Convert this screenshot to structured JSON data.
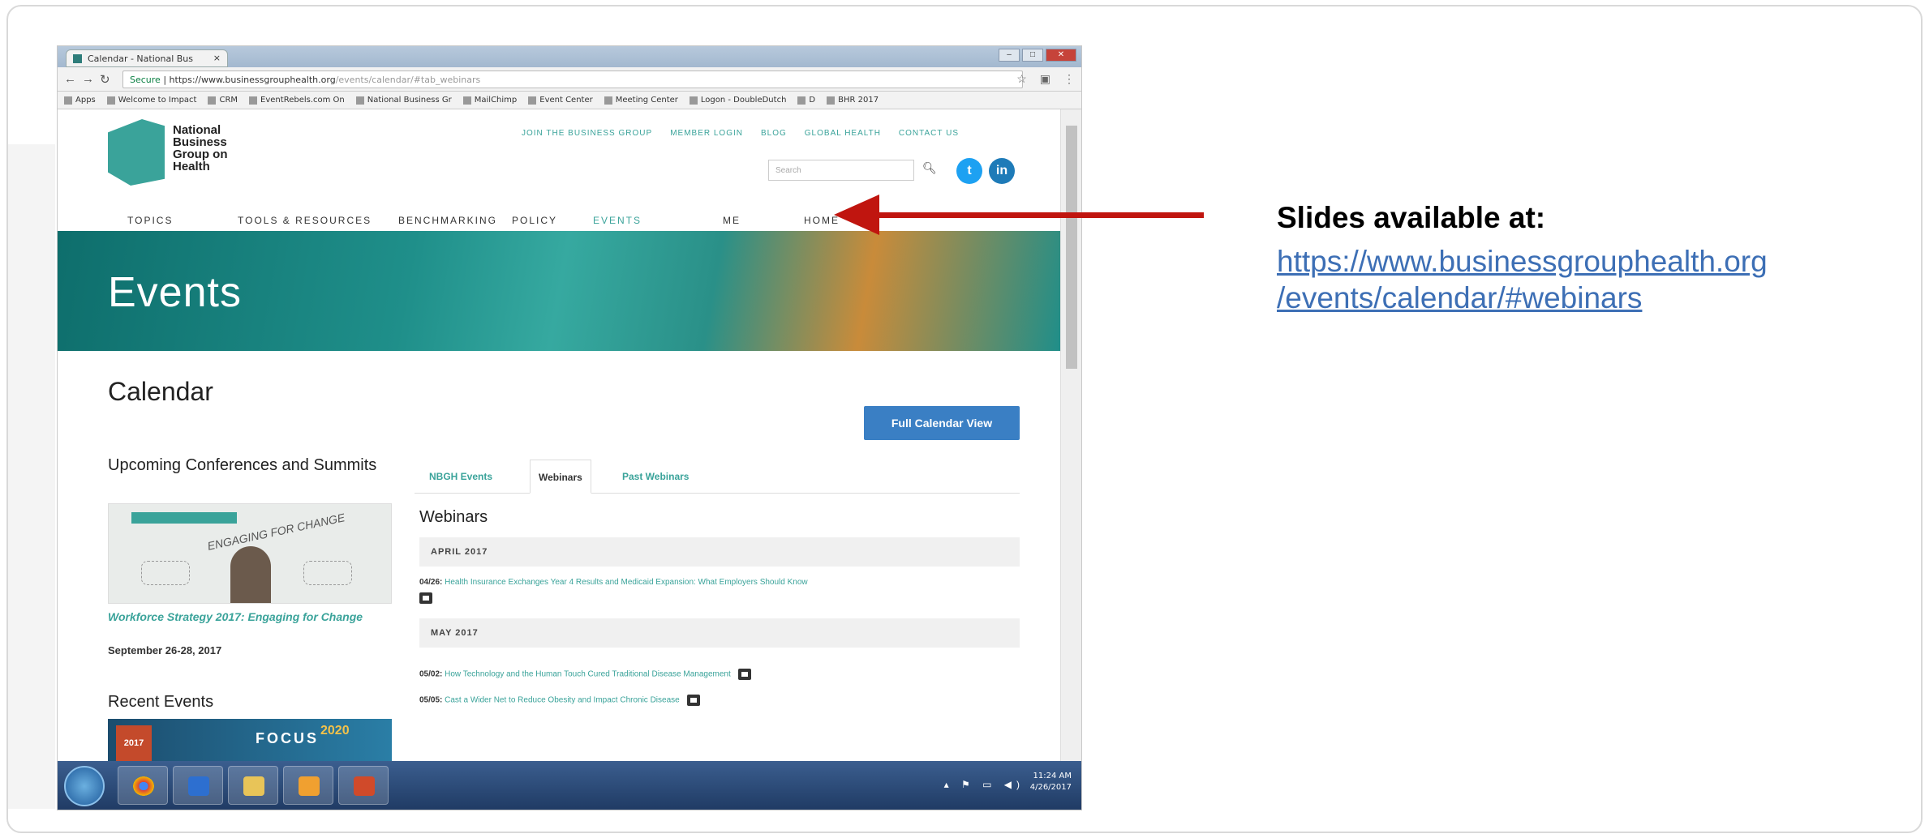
{
  "callout": {
    "label": "Slides available at:",
    "url_line1": "https://www.businessgrouphealth.org",
    "url_line2": "/events/calendar/#webinars"
  },
  "browser": {
    "tab_title": "Calendar - National Bus",
    "tab_close": "×",
    "address": {
      "secure_label": "Secure",
      "url": "https://www.businessgrouphealth.org",
      "url_path": "/events/calendar/#tab_webinars"
    },
    "bookmarks": [
      "Apps",
      "Welcome to Impact",
      "CRM",
      "EventRebels.com On",
      "National Business Gr",
      "MailChimp",
      "Event Center",
      "Meeting Center",
      "Logon - DoubleDutch",
      "D",
      "BHR 2017"
    ]
  },
  "site": {
    "logo_text": [
      "National",
      "Business",
      "Group on",
      "Health"
    ],
    "utility_links": [
      "JOIN THE BUSINESS GROUP",
      "MEMBER LOGIN",
      "BLOG",
      "GLOBAL HEALTH",
      "CONTACT US"
    ],
    "search_placeholder": "Search",
    "social": {
      "twitter": "t",
      "linkedin": "in"
    },
    "nav": [
      "TOPICS",
      "TOOLS & RESOURCES",
      "BENCHMARKING",
      "POLICY",
      "EVENTS",
      "ME",
      "HOME"
    ],
    "hero_title": "Events",
    "page_title": "Calendar",
    "full_calendar_button": "Full Calendar View",
    "sidebar": {
      "conferences_heading": "Upcoming Conferences and Summits",
      "conference_link": "Workforce Strategy 2017: Engaging for Change",
      "conference_date": "September 26-28, 2017",
      "conference_image_caption": "ENGAGING FOR CHANGE",
      "recent_heading": "Recent Events",
      "recent_image_text": "FOCUS",
      "recent_image_year": "2020",
      "recent_image_badge": "2017"
    },
    "tabs": [
      "NBGH Events",
      "Webinars",
      "Past Webinars"
    ],
    "webinars_heading": "Webinars",
    "months": [
      {
        "label": "APRIL 2017",
        "events": [
          {
            "date": "04/26:",
            "title": "Health Insurance Exchanges Year 4 Results and Medicaid Expansion: What Employers Should Know"
          }
        ]
      },
      {
        "label": "MAY 2017",
        "events": [
          {
            "date": "05/02:",
            "title": "How Technology and the Human Touch Cured Traditional Disease Management"
          },
          {
            "date": "05/05:",
            "title": "Cast a Wider Net to Reduce Obesity and Impact Chronic Disease"
          }
        ]
      }
    ]
  },
  "taskbar": {
    "time": "11:24 AM",
    "date": "4/26/2017"
  },
  "colors": {
    "arrow": "#c0150f",
    "link": "#3d6fb5",
    "brand_teal": "#3aa39a",
    "button_blue": "#3a7fc4"
  }
}
